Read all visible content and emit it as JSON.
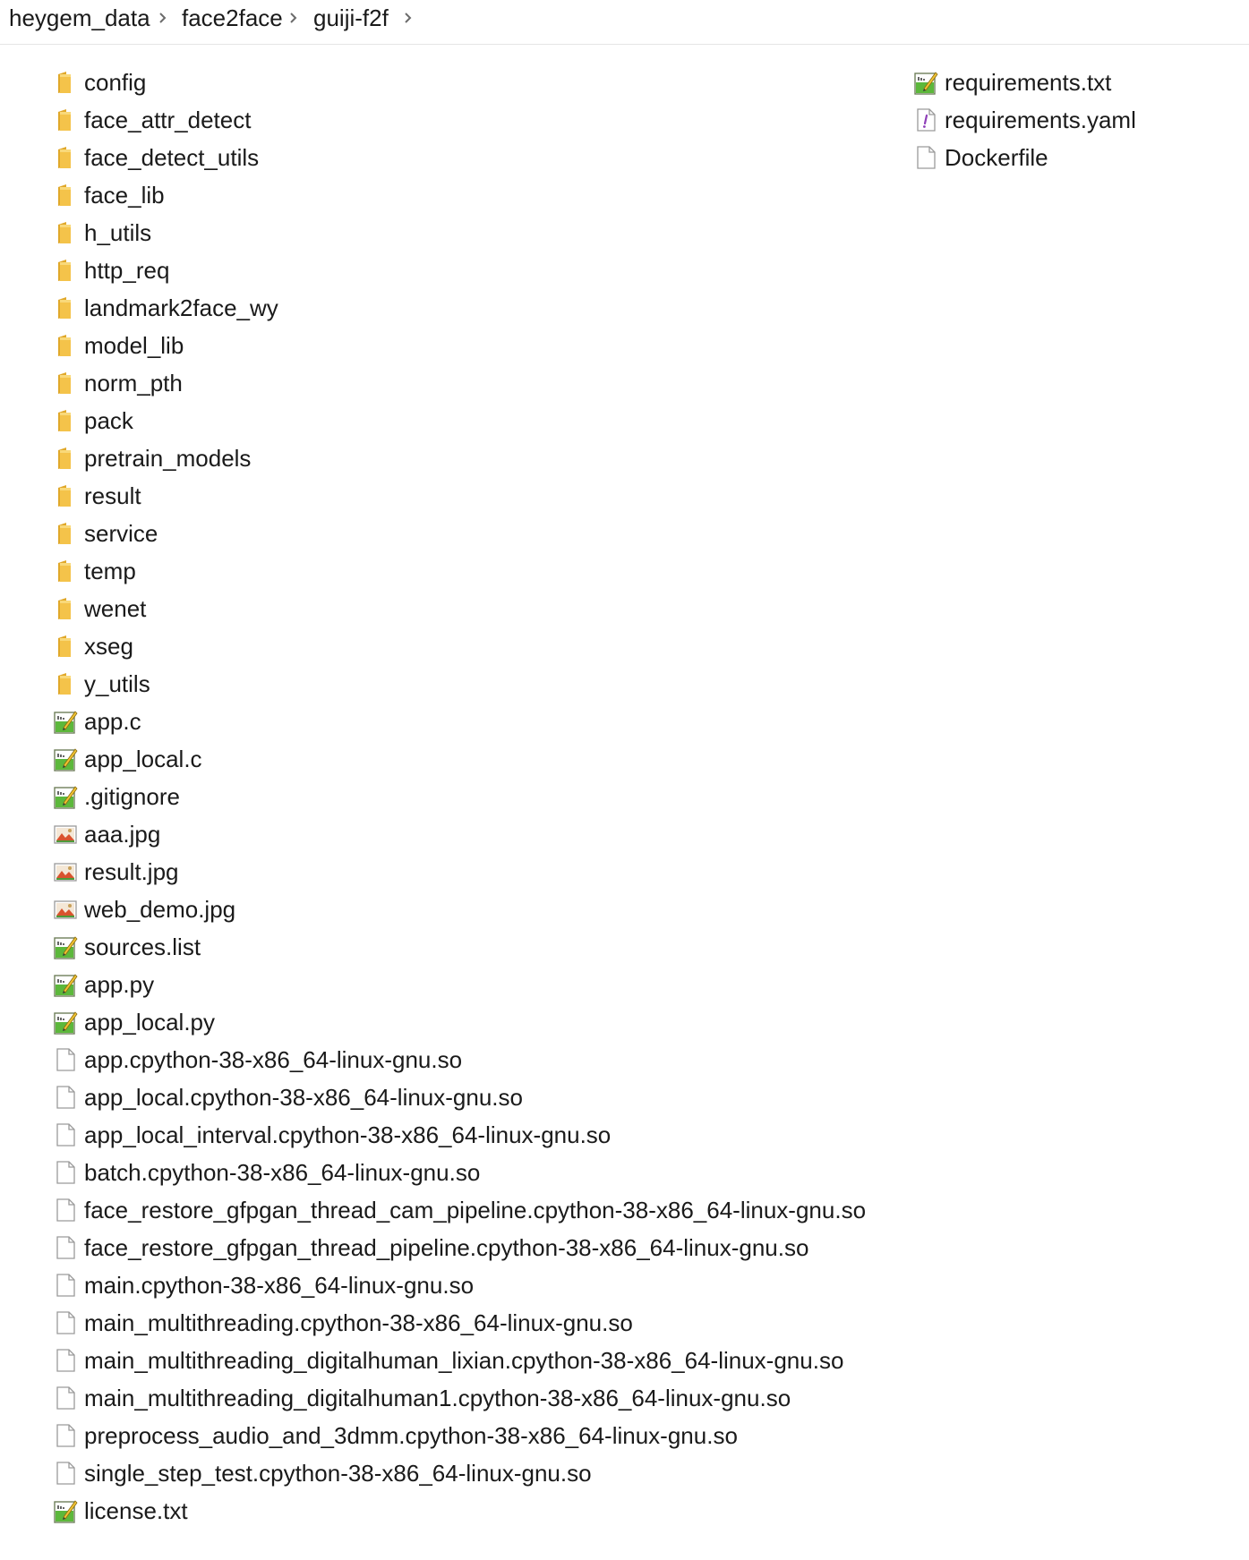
{
  "breadcrumb": {
    "items": [
      "heygem_data",
      "face2face",
      "guiji-f2f"
    ]
  },
  "colors": {
    "folder": "#f4c34a",
    "text": "#1a1a1a",
    "divider": "#e5e5e5",
    "chevron": "#6b6b6b"
  },
  "files_left": [
    {
      "name": "config",
      "icon": "folder-icon"
    },
    {
      "name": "face_attr_detect",
      "icon": "folder-icon"
    },
    {
      "name": "face_detect_utils",
      "icon": "folder-icon"
    },
    {
      "name": "face_lib",
      "icon": "folder-icon"
    },
    {
      "name": "h_utils",
      "icon": "folder-icon"
    },
    {
      "name": "http_req",
      "icon": "folder-icon"
    },
    {
      "name": "landmark2face_wy",
      "icon": "folder-icon"
    },
    {
      "name": "model_lib",
      "icon": "folder-icon"
    },
    {
      "name": "norm_pth",
      "icon": "folder-icon"
    },
    {
      "name": "pack",
      "icon": "folder-icon"
    },
    {
      "name": "pretrain_models",
      "icon": "folder-icon"
    },
    {
      "name": "result",
      "icon": "folder-icon"
    },
    {
      "name": "service",
      "icon": "folder-icon"
    },
    {
      "name": "temp",
      "icon": "folder-icon"
    },
    {
      "name": "wenet",
      "icon": "folder-icon"
    },
    {
      "name": "xseg",
      "icon": "folder-icon"
    },
    {
      "name": "y_utils",
      "icon": "folder-icon"
    },
    {
      "name": "app.c",
      "icon": "notepad-file-icon"
    },
    {
      "name": "app_local.c",
      "icon": "notepad-file-icon"
    },
    {
      "name": ".gitignore",
      "icon": "notepad-file-icon"
    },
    {
      "name": "aaa.jpg",
      "icon": "image-file-icon"
    },
    {
      "name": "result.jpg",
      "icon": "image-file-icon"
    },
    {
      "name": "web_demo.jpg",
      "icon": "image-file-icon"
    },
    {
      "name": "sources.list",
      "icon": "notepad-file-icon"
    },
    {
      "name": "app.py",
      "icon": "notepad-file-icon"
    },
    {
      "name": "app_local.py",
      "icon": "notepad-file-icon"
    },
    {
      "name": "app.cpython-38-x86_64-linux-gnu.so",
      "icon": "blank-file-icon"
    },
    {
      "name": "app_local.cpython-38-x86_64-linux-gnu.so",
      "icon": "blank-file-icon"
    },
    {
      "name": "app_local_interval.cpython-38-x86_64-linux-gnu.so",
      "icon": "blank-file-icon"
    },
    {
      "name": "batch.cpython-38-x86_64-linux-gnu.so",
      "icon": "blank-file-icon"
    },
    {
      "name": "face_restore_gfpgan_thread_cam_pipeline.cpython-38-x86_64-linux-gnu.so",
      "icon": "blank-file-icon"
    },
    {
      "name": "face_restore_gfpgan_thread_pipeline.cpython-38-x86_64-linux-gnu.so",
      "icon": "blank-file-icon"
    },
    {
      "name": "main.cpython-38-x86_64-linux-gnu.so",
      "icon": "blank-file-icon"
    },
    {
      "name": "main_multithreading.cpython-38-x86_64-linux-gnu.so",
      "icon": "blank-file-icon"
    },
    {
      "name": "main_multithreading_digitalhuman_lixian.cpython-38-x86_64-linux-gnu.so",
      "icon": "blank-file-icon"
    },
    {
      "name": "main_multithreading_digitalhuman1.cpython-38-x86_64-linux-gnu.so",
      "icon": "blank-file-icon"
    },
    {
      "name": "preprocess_audio_and_3dmm.cpython-38-x86_64-linux-gnu.so",
      "icon": "blank-file-icon"
    },
    {
      "name": "single_step_test.cpython-38-x86_64-linux-gnu.so",
      "icon": "blank-file-icon"
    },
    {
      "name": "license.txt",
      "icon": "notepad-file-icon"
    }
  ],
  "files_right": [
    {
      "name": "requirements.txt",
      "icon": "notepad-file-icon"
    },
    {
      "name": "requirements.yaml",
      "icon": "yaml-file-icon"
    },
    {
      "name": "Dockerfile",
      "icon": "blank-file-icon"
    }
  ]
}
